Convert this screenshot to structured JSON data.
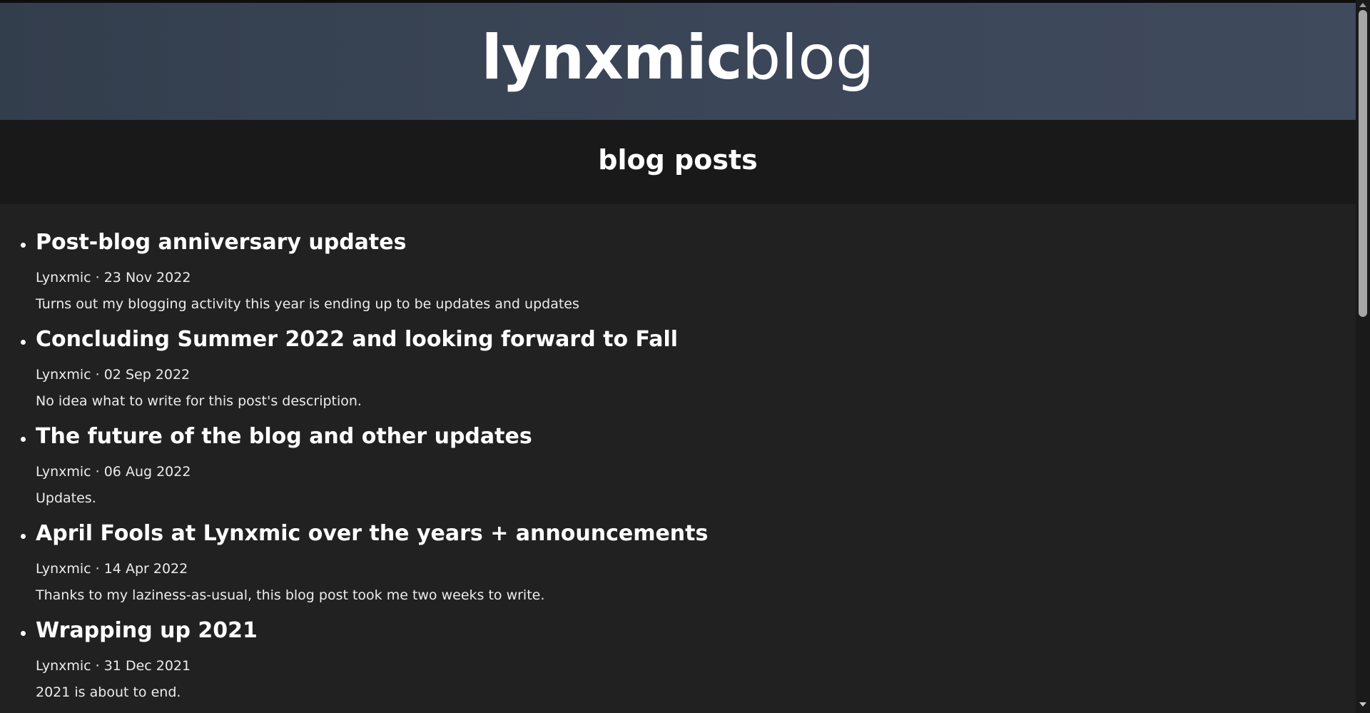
{
  "logo": {
    "strong": "lynxmic",
    "light": "blog"
  },
  "section": {
    "title": "blog posts"
  },
  "posts": [
    {
      "title": "Post-blog anniversary updates",
      "meta": "Lynxmic · 23 Nov 2022",
      "description": "Turns out my blogging activity this year is ending up to be updates and updates"
    },
    {
      "title": "Concluding Summer 2022 and looking forward to Fall",
      "meta": "Lynxmic · 02 Sep 2022",
      "description": "No idea what to write for this post's description."
    },
    {
      "title": "The future of the blog and other updates",
      "meta": "Lynxmic · 06 Aug 2022",
      "description": "Updates."
    },
    {
      "title": "April Fools at Lynxmic over the years + announcements",
      "meta": "Lynxmic · 14 Apr 2022",
      "description": "Thanks to my laziness-as-usual, this blog post took me two weeks to write."
    },
    {
      "title": "Wrapping up 2021",
      "meta": "Lynxmic · 31 Dec 2021",
      "description": "2021 is about to end."
    }
  ],
  "colors": {
    "banner": "#3b4658",
    "section_header": "#191919",
    "content": "#212121",
    "text": "#ffffff"
  }
}
